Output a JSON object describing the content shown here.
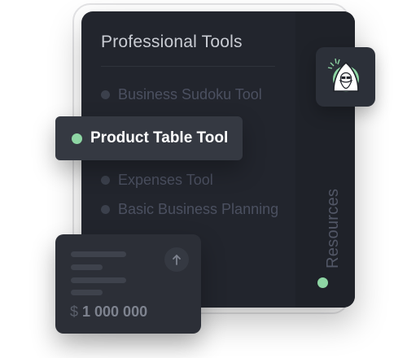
{
  "panel": {
    "title": "Professional Tools",
    "items": [
      {
        "label": "Business Sudoku Tool"
      },
      {
        "label": "Product Table Tool"
      },
      {
        "label": "Expenses Tool"
      },
      {
        "label": "Basic Business Planning"
      }
    ],
    "active_index": 1
  },
  "side_tab": {
    "label": "Resources"
  },
  "money_card": {
    "currency": "$",
    "amount": "1 000 000"
  },
  "icons": {
    "avatar": "wizard-avatar-icon",
    "upload": "arrow-up-icon"
  },
  "colors": {
    "accent": "#8ed6a4",
    "card_bg": "#22252d",
    "active_bg": "#353942"
  }
}
